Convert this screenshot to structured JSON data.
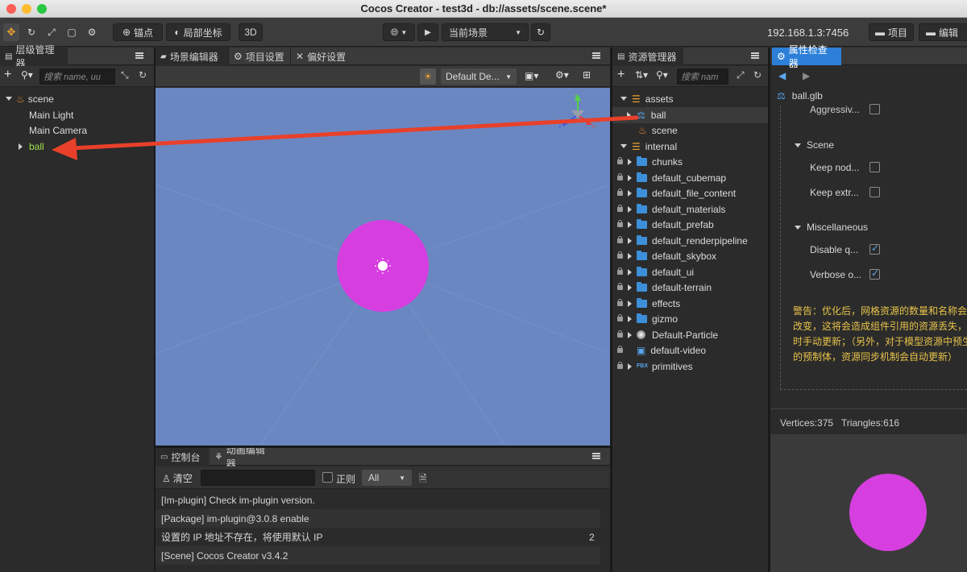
{
  "window": {
    "title": "Cocos Creator - test3d - db://assets/scene.scene*"
  },
  "toolbar": {
    "anchor_label": "锚点",
    "local_coord_label": "局部坐标",
    "mode_3d": "3D",
    "current_scene": "当前场景",
    "ip": "192.168.1.3:7456",
    "project_label": "项目",
    "editor_label": "编辑"
  },
  "hierarchy": {
    "tab": "层级管理器",
    "search_placeholder": "搜索 name, uu",
    "nodes": [
      {
        "label": "scene"
      },
      {
        "label": "Main Light"
      },
      {
        "label": "Main Camera"
      },
      {
        "label": "ball"
      }
    ]
  },
  "scene_editor": {
    "tabs": [
      "场景编辑器",
      "项目设置",
      "偏好设置"
    ],
    "layout_select": "Default De..."
  },
  "assets": {
    "tab": "资源管理器",
    "search_placeholder": "搜索 nam",
    "items": [
      {
        "label": "assets"
      },
      {
        "label": "ball"
      },
      {
        "label": "scene"
      },
      {
        "label": "internal"
      },
      {
        "label": "chunks"
      },
      {
        "label": "default_cubemap"
      },
      {
        "label": "default_file_content"
      },
      {
        "label": "default_materials"
      },
      {
        "label": "default_prefab"
      },
      {
        "label": "default_renderpipeline"
      },
      {
        "label": "default_skybox"
      },
      {
        "label": "default_ui"
      },
      {
        "label": "default-terrain"
      },
      {
        "label": "effects"
      },
      {
        "label": "gizmo"
      },
      {
        "label": "Default-Particle"
      },
      {
        "label": "default-video"
      },
      {
        "label": "primitives"
      }
    ]
  },
  "inspector": {
    "tab": "属性检查器",
    "file": "ball.glb",
    "aggressive": "Aggressiv...",
    "scene_section": "Scene",
    "keep_nodes": "Keep nod...",
    "keep_extras": "Keep extr...",
    "misc_section": "Miscellaneous",
    "disable_q": "Disable q...",
    "verbose": "Verbose o...",
    "warning_lines": [
      "警告：优化后，网格资源的数量和名称会发",
      "改变，这将会造成组件引用的资源丢失，请",
      "时手动更新；（另外，对于模型资源中预生",
      "的预制体，资源同步机制会自动更新）"
    ],
    "stats": "Vertices:375   Triangles:616"
  },
  "console": {
    "tabs": [
      "控制台",
      "动画编辑器"
    ],
    "clear_label": "清空",
    "regex_label": "正则",
    "level_select": "All",
    "logs": [
      {
        "text": "[Im-plugin] Check im-plugin version.",
        "count": ""
      },
      {
        "text": "[Package] im-plugin@3.0.8 enable",
        "count": ""
      },
      {
        "text": "设置的 IP 地址不存在，将使用默认 IP",
        "count": "2"
      },
      {
        "text": "[Scene] Cocos Creator v3.4.2",
        "count": ""
      }
    ]
  },
  "colors": {
    "scene_bg": "#6b87c2",
    "ball": "#d63ee0",
    "arrow": "#e8402a",
    "accent": "#2d7fd8",
    "warning": "#e8c34a"
  }
}
